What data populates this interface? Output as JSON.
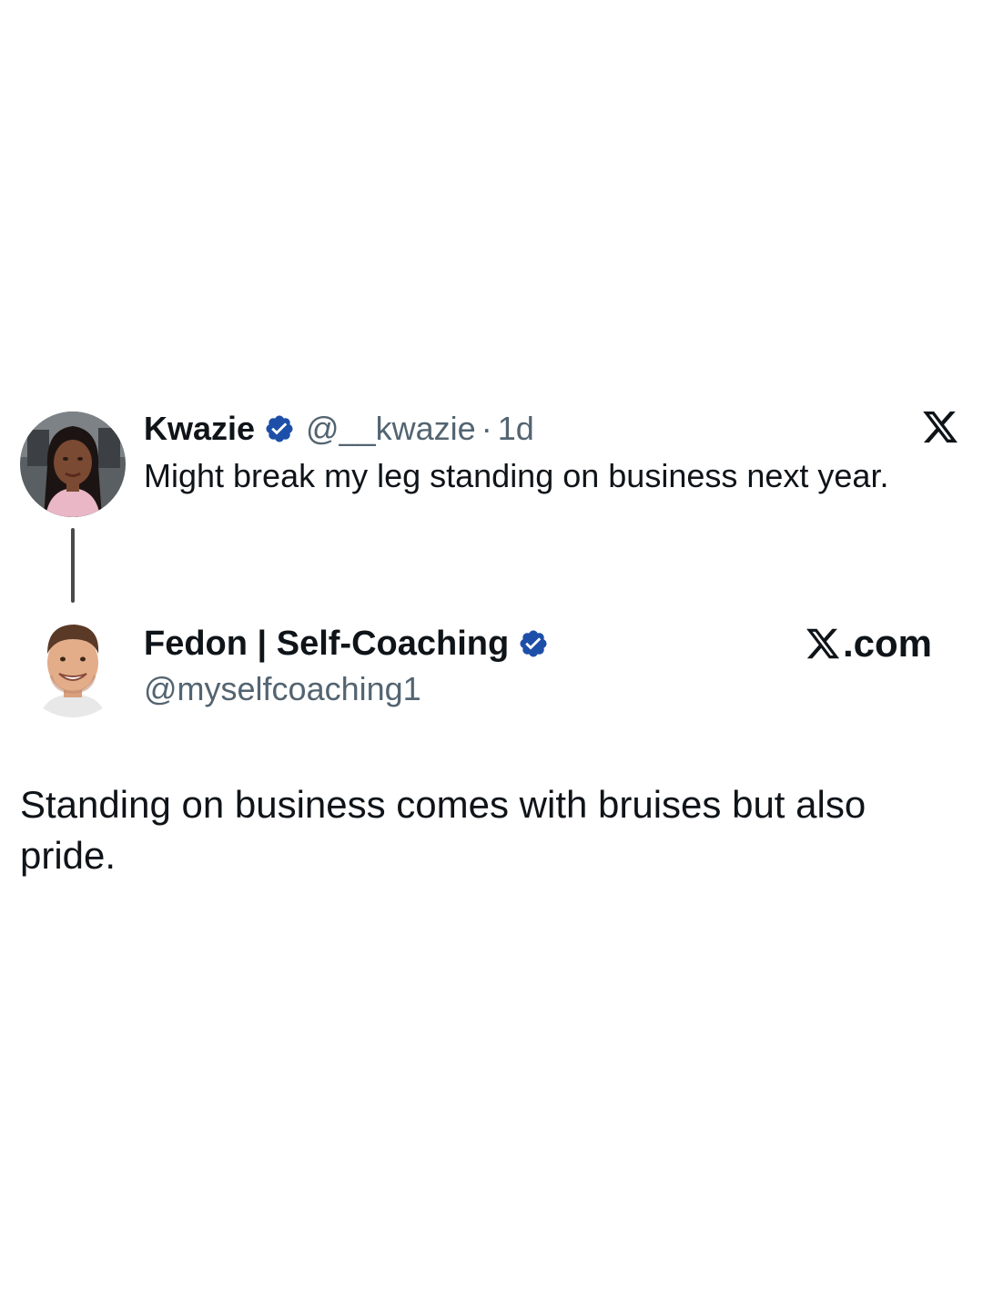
{
  "original_tweet": {
    "author_name": "Kwazie",
    "handle": "@__kwazie",
    "separator": "·",
    "time": "1d",
    "text": "Might break my leg standing on business next year.",
    "avatar_icon": "woman-avatar",
    "verified_icon": "verified-badge-icon"
  },
  "reply_tweet": {
    "author_name": "Fedon | Self-Coaching",
    "handle": "@myselfcoaching1",
    "text": "Standing on business comes with bruises but also pride.",
    "avatar_icon": "man-avatar",
    "verified_icon": "verified-badge-icon"
  },
  "branding": {
    "x_logo_icon": "x-logo-icon",
    "site_text": ".com"
  },
  "colors": {
    "text_primary": "#0f1419",
    "text_secondary": "#536471",
    "verified_blue": "#1d9bf0",
    "thread_line": "#4a4a4a",
    "background": "#ffffff"
  }
}
